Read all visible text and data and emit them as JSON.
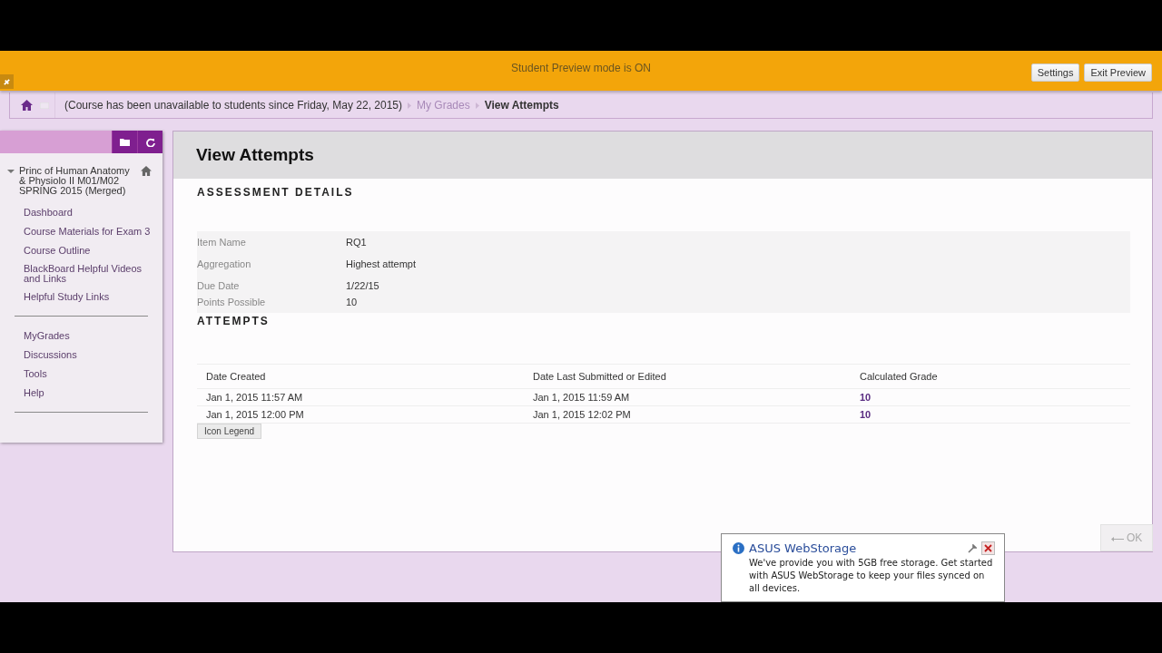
{
  "preview_bar": {
    "message": "Student Preview mode is ON",
    "buttons": [
      "Settings",
      "Exit Preview"
    ]
  },
  "breadcrumb": {
    "items": [
      "(Course has been unavailable to students since Friday, May 22, 2015)",
      "My Grades",
      "View Attempts"
    ]
  },
  "sidebar": {
    "course_title": "Princ of Human Anatomy & Physiolo II M01/M02 SPRING 2015 (Merged)",
    "expanded": true,
    "groups": [
      [
        "Dashboard",
        "Course Materials for Exam 3",
        "Course Outline",
        "BlackBoard Helpful Videos and Links",
        "Helpful Study Links"
      ],
      [
        "MyGrades",
        "Discussions",
        "Tools",
        "Help"
      ]
    ]
  },
  "page": {
    "title": "View Attempts",
    "details_heading": "ASSESSMENT DETAILS",
    "details": [
      {
        "label": "Item Name",
        "value": "RQ1"
      },
      {
        "label": "Aggregation",
        "value": "Highest attempt"
      },
      {
        "label": "Due Date",
        "value": "1/22/15"
      },
      {
        "label": "Points Possible",
        "value": "10"
      }
    ],
    "attempts_heading": "ATTEMPTS",
    "table": {
      "columns": [
        "Date Created",
        "Date Last Submitted or Edited",
        "Calculated Grade"
      ],
      "rows": [
        [
          "Jan 1, 2015 11:57 AM",
          "Jan 1, 2015 11:59 AM",
          "10"
        ],
        [
          "Jan 1, 2015 12:00 PM",
          "Jan 1, 2015 12:02 PM",
          "10"
        ]
      ]
    },
    "legend_button": "Icon Legend",
    "ok_button": "OK"
  },
  "notification": {
    "title": "ASUS WebStorage",
    "message": "We've provide you with 5GB free storage. Get started with ASUS WebStorage to keep your files synced on all devices."
  }
}
